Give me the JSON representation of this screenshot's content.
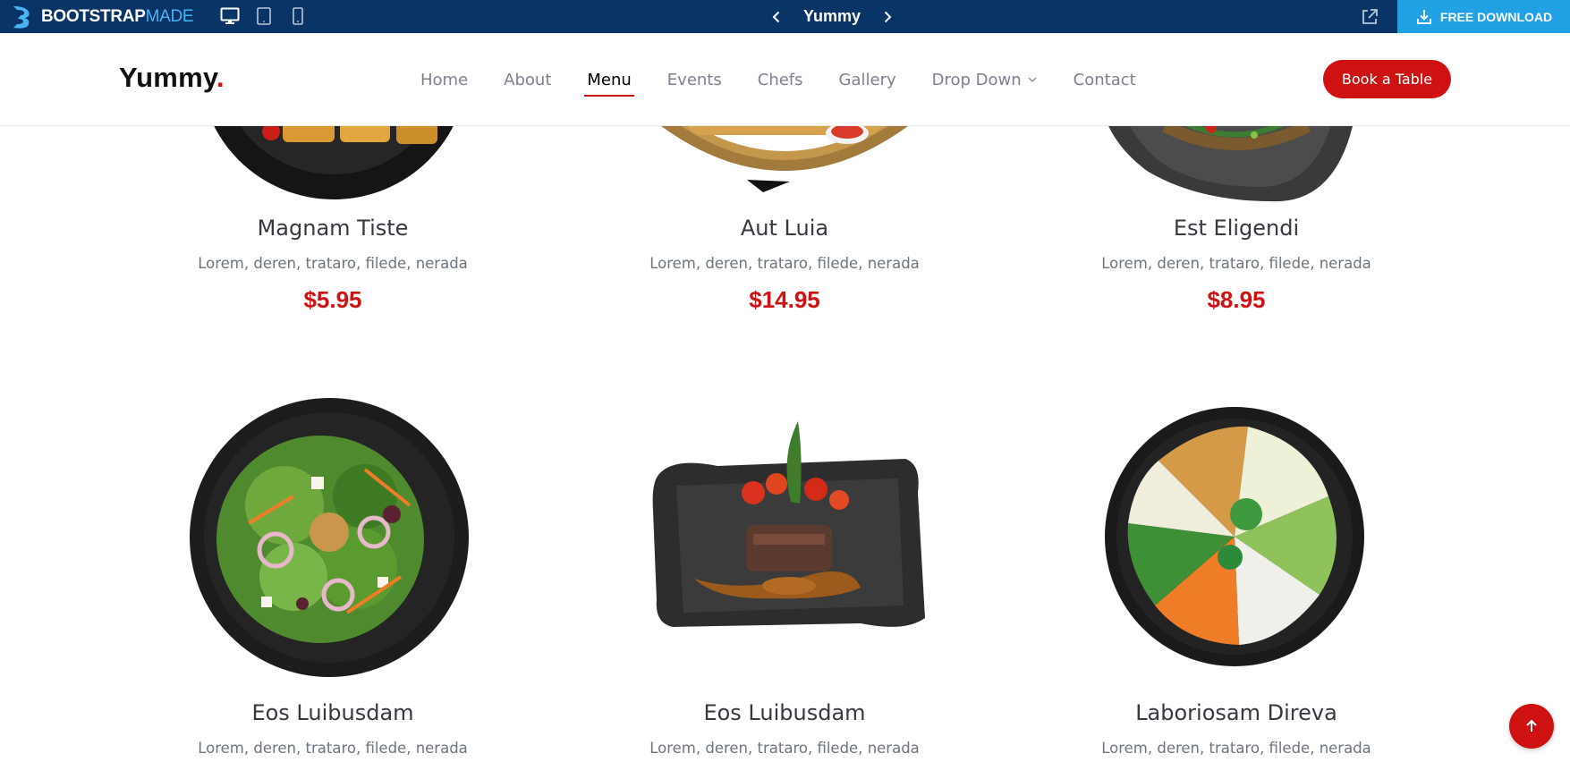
{
  "topbar": {
    "logo_main": "BOOTSTRAP",
    "logo_accent": "MADE",
    "title": "Yummy",
    "download_label": "FREE DOWNLOAD",
    "background_color": "#0a3366",
    "download_color": "#1fa1e4"
  },
  "header": {
    "brand": "Yummy",
    "brand_dot": ".",
    "accent_color": "#ce1212",
    "nav": [
      {
        "label": "Home"
      },
      {
        "label": "About"
      },
      {
        "label": "Menu",
        "active": true
      },
      {
        "label": "Events"
      },
      {
        "label": "Chefs"
      },
      {
        "label": "Gallery"
      },
      {
        "label": "Drop Down",
        "has_dropdown": true
      },
      {
        "label": "Contact"
      }
    ],
    "cta": "Book a Table"
  },
  "menu": {
    "items": [
      {
        "name": "Magnam Tiste",
        "ingredients": "Lorem, deren, trataro, filede, nerada",
        "price": "$5.95"
      },
      {
        "name": "Aut Luia",
        "ingredients": "Lorem, deren, trataro, filede, nerada",
        "price": "$14.95"
      },
      {
        "name": "Est Eligendi",
        "ingredients": "Lorem, deren, trataro, filede, nerada",
        "price": "$8.95"
      },
      {
        "name": "Eos Luibusdam",
        "ingredients": "Lorem, deren, trataro, filede, nerada"
      },
      {
        "name": "Eos Luibusdam",
        "ingredients": "Lorem, deren, trataro, filede, nerada"
      },
      {
        "name": "Laboriosam Direva",
        "ingredients": "Lorem, deren, trataro, filede, nerada"
      }
    ]
  },
  "icons": {
    "devices": [
      "desktop-icon",
      "tablet-icon",
      "mobile-icon"
    ],
    "nav_arrows": [
      "chevron-left-icon",
      "chevron-right-icon"
    ],
    "external": "external-link-icon",
    "download": "download-icon",
    "scroll_top": "arrow-up-icon"
  }
}
